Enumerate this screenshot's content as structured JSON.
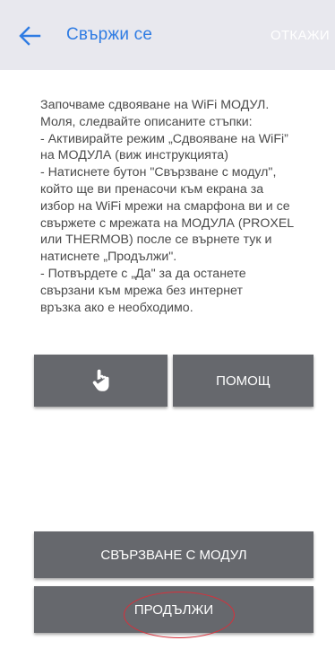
{
  "header": {
    "title": "Свържи се",
    "cancel_label": "ОТКАЖИ",
    "back_icon": "arrow-left-icon",
    "accent_color": "#2f7ce3"
  },
  "instructions": {
    "lines": [
      "Започваме сдвояване на WiFi МОДУЛ.",
      "Моля, следвайте описаните стъпки:",
      "- Активирайте режим „Сдвояване на WiFi”",
      "на МОДУЛА (виж инструкцията)",
      "- Натиснете бутон \"Свързване с модул\",",
      "който ще ви пренасочи към екрана за",
      "избор на WiFi мрежи на смарфона ви и се",
      "свържете с мрежата на МОДУЛА (PROXEL",
      "или THERMOB) после се върнете тук и",
      "натиснете „Продължи\".",
      "- Потвърдете с „Да\" за да останете",
      "свързани към мрежа без интернет",
      "връзка  ако е необходимо."
    ]
  },
  "buttons": {
    "hand_icon": "hand-pointer-icon",
    "help_label": "ПОМОЩ",
    "connect_label": "СВЪРЗВАНЕ С МОДУЛ",
    "continue_label": "ПРОДЪЛЖИ",
    "button_color": "#66686d"
  },
  "highlight_color": "#d7303b"
}
